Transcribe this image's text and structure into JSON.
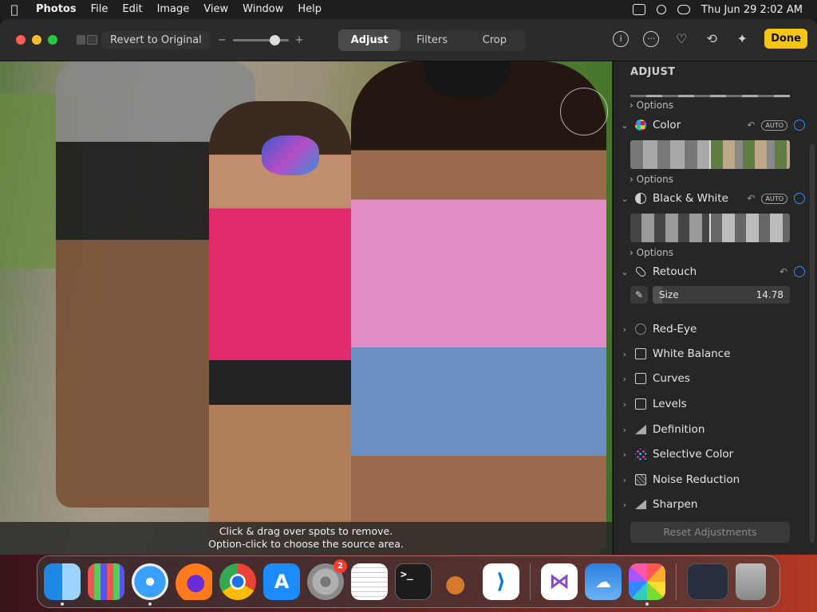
{
  "menubar": {
    "apple": "",
    "app": "Photos",
    "items": [
      "File",
      "Edit",
      "Image",
      "View",
      "Window",
      "Help"
    ],
    "clock": "Thu Jun 29  2:02 AM"
  },
  "toolbar": {
    "revert": "Revert to Original",
    "zoom_minus": "−",
    "zoom_plus": "+",
    "zoom_level": 0.75,
    "tabs": [
      "Adjust",
      "Filters",
      "Crop"
    ],
    "active_tab": "Adjust",
    "done": "Done"
  },
  "photo": {
    "hint_line1": "Click & drag over spots to remove.",
    "hint_line2": "Option-click to choose the source area."
  },
  "sidebar": {
    "title": "ADJUST",
    "options": "Options",
    "auto": "AUTO",
    "color": "Color",
    "bw": "Black & White",
    "retouch": "Retouch",
    "size_label": "Size",
    "size_value": "14.78",
    "size_fill": 0.07,
    "items": [
      "Red-Eye",
      "White Balance",
      "Curves",
      "Levels",
      "Definition",
      "Selective Color",
      "Noise Reduction",
      "Sharpen"
    ],
    "reset": "Reset Adjustments"
  },
  "dock": {
    "settings_badge": "2"
  }
}
